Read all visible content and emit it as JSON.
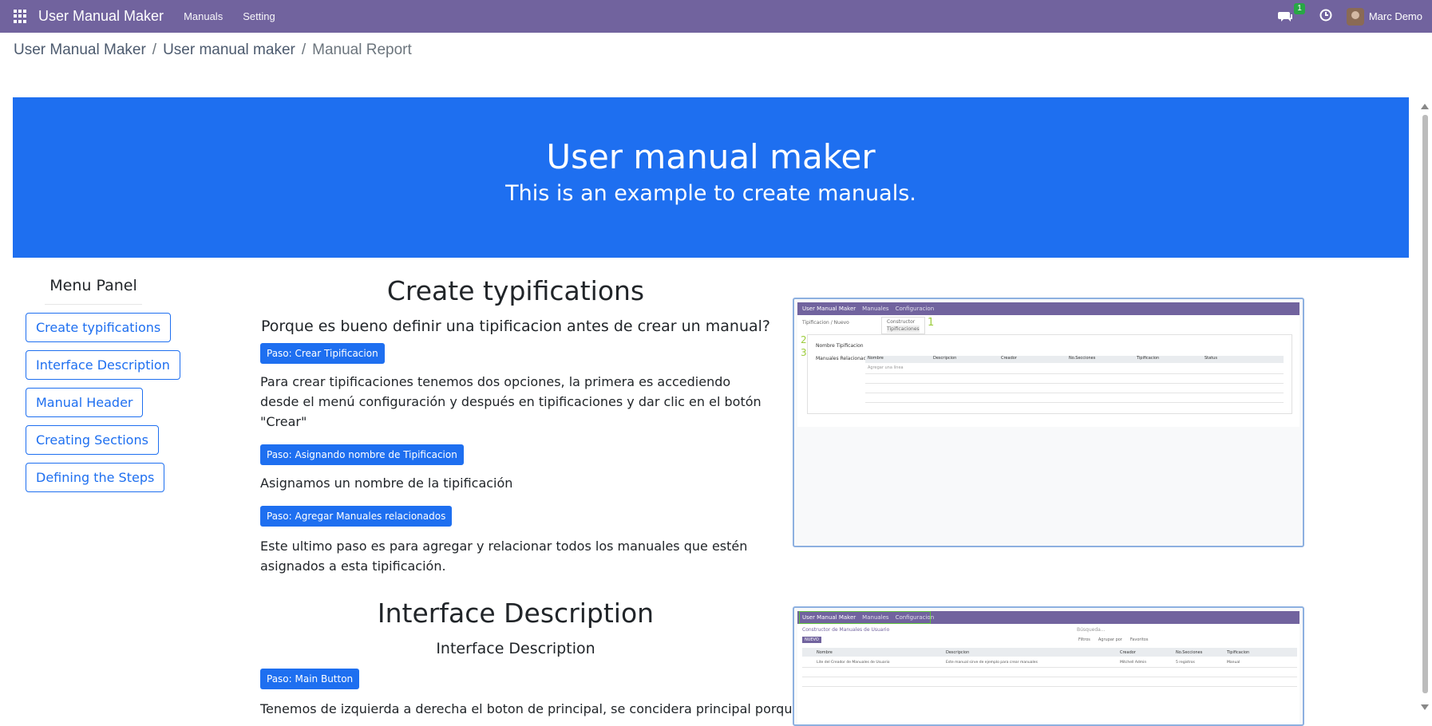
{
  "navbar": {
    "brand": "User Manual Maker",
    "menu": [
      "Manuals",
      "Setting"
    ],
    "chat_badge": "1",
    "user_name": "Marc Demo"
  },
  "breadcrumb": {
    "items": [
      "User Manual Maker",
      "User manual maker",
      "Manual Report"
    ],
    "separator": "/"
  },
  "hero": {
    "title": "User manual maker",
    "subtitle": "This is an example to create manuals."
  },
  "menu_panel": {
    "title": "Menu Panel",
    "items": [
      "Create typifications",
      "Interface Description",
      "Manual Header",
      "Creating Sections",
      "Defining the Steps"
    ]
  },
  "section1": {
    "title": "Create typifications",
    "subtitle": "Porque es bueno definir una tipificacion antes de crear un manual?",
    "steps": [
      {
        "button": "Paso: Crear Tipificacion",
        "text": "Para crear tipificaciones tenemos dos opciones, la primera es accediendo desde el menú configuración y después en tipificaciones y dar clic en el botón \"Crear\""
      },
      {
        "button": "Paso: Asignando nombre de Tipificacion",
        "text": "Asignamos un nombre de la tipificación"
      },
      {
        "button": "Paso: Agregar Manuales relacionados",
        "text": "Este ultimo paso es para agregar y relacionar todos los manuales que estén asignados a esta tipificación."
      }
    ],
    "screenshot": {
      "brand": "User Manual Maker",
      "menu": [
        "Manuales",
        "Configuracion"
      ],
      "breadcrumb": "Tipificacion / Nuevo",
      "dropdown": [
        "Constructor",
        "Tipificaciones"
      ],
      "fields": [
        "Nombre Tipificacion",
        "Manuales Relacionados"
      ],
      "columns": [
        "Nombre",
        "Descripcion",
        "Creador",
        "No.Secciones",
        "Tipificacion",
        "Status"
      ],
      "add_line": "Agregar una línea",
      "markers": [
        "1",
        "2",
        "3"
      ]
    }
  },
  "section2": {
    "title": "Interface Description",
    "subtitle": "Interface Description",
    "steps": [
      {
        "button": "Paso: Main Button",
        "text": "Tenemos de izquierda a derecha el boton de principal, se concidera principal porque lleva"
      }
    ],
    "screenshot": {
      "brand": "User Manual Maker",
      "menu": [
        "Manuales",
        "Configuracion"
      ],
      "title": "Constructor de Manuales de Usuario",
      "search": "Búsqueda...",
      "new_button": "NUEVO",
      "filters": [
        "Filtros",
        "Agrupar por",
        "Favoritos"
      ],
      "columns": [
        "Nombre",
        "Descripcion",
        "Creador",
        "No.Secciones",
        "Tipificacion"
      ],
      "row": [
        "Lite del Creador de Manuales de Usuario",
        "Este manual sirve de ejemplo para crear manuales",
        "Mitchell Admin",
        "5 registros",
        "Manual"
      ]
    }
  },
  "colors": {
    "navbar": "#71639e",
    "primary": "#1e6ff0"
  }
}
